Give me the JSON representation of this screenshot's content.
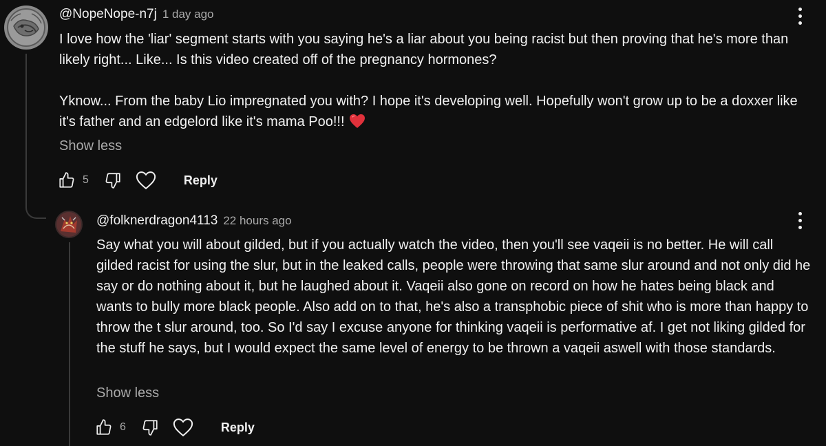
{
  "comment": {
    "handle": "@NopeNope-n7j",
    "time": "1 day ago",
    "body_line_1": "I love how the 'liar' segment starts with you saying he's a liar about you being racist but then proving that he's more than likely right... Like... Is this video created off of the pregnancy hormones?",
    "body_line_2": "Yknow... From the baby Lio impregnated you with? I hope it's developing well. Hopefully won't grow up to be a doxxer like it's father and an edgelord like it's mama Poo!!!",
    "show_less": "Show less",
    "likes": "5",
    "reply_label": "Reply"
  },
  "reply": {
    "handle": "@folknerdragon4113",
    "time": "22 hours ago",
    "body": "Say what you will about gilded, but if you actually watch the video, then you'll see vaqeii is no better. He will call gilded racist for using the slur, but in the leaked calls, people were throwing that same slur around and not only did he say or do nothing about it, but he laughed about it. Vaqeii also gone on record on how he hates being black and wants to bully more black people. Also add on to that, he's also a transphobic piece of shit who is more than happy to throw the t slur around, too. So I'd say I excuse anyone for thinking vaqeii is performative af. I get not liking gilded for the stuff he says, but I would expect the same level of energy to be thrown a vaqeii aswell with those standards.",
    "show_less": "Show less",
    "likes": "6",
    "reply_label": "Reply"
  },
  "icons": {
    "like": "thumbs-up-icon",
    "dislike": "thumbs-down-icon",
    "heart": "heart-outline-icon",
    "more": "more-vertical-icon",
    "emoji": "red-heart-emoji"
  },
  "colors": {
    "background": "#0f0f0f",
    "text": "#f1f1f1",
    "secondary_text": "#aaaaaa",
    "heart_emoji": "#e0313b"
  }
}
